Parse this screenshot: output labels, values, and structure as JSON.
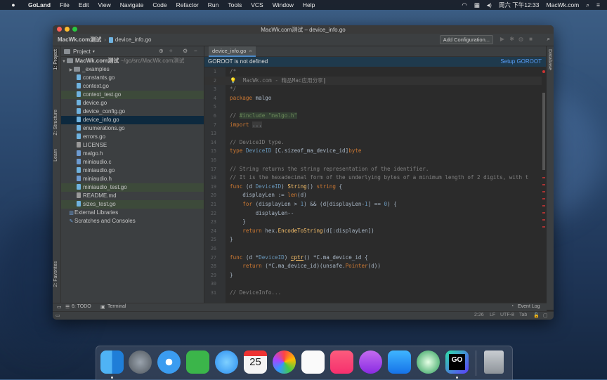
{
  "menubar": {
    "apple": "",
    "app": "GoLand",
    "items": [
      "File",
      "Edit",
      "View",
      "Navigate",
      "Code",
      "Refactor",
      "Run",
      "Tools",
      "VCS",
      "Window",
      "Help"
    ],
    "clock": "周六 下午12:33",
    "hostname": "MacWk.com"
  },
  "window": {
    "title": "MacWk.com测试 – device_info.go",
    "breadcrumb_project": "MacWk.com测试",
    "breadcrumb_file": "device_info.go",
    "add_configuration": "Add Configuration..."
  },
  "left_strip": {
    "project": "1: Project",
    "structure": "Z: Structure",
    "learn": "Learn",
    "favorites": "2: Favorites"
  },
  "right_strip": {
    "database": "Database"
  },
  "project_panel": {
    "title": "Project",
    "root_name": "MacWk.com测试",
    "root_path": "~/go/src/MacWk.com测试",
    "folder_examples": "_examples",
    "files": [
      {
        "name": "constants.go",
        "kind": "go",
        "modified": false
      },
      {
        "name": "context.go",
        "kind": "go",
        "modified": false
      },
      {
        "name": "context_test.go",
        "kind": "go",
        "modified": true
      },
      {
        "name": "device.go",
        "kind": "go",
        "modified": false
      },
      {
        "name": "device_config.go",
        "kind": "go",
        "modified": false
      },
      {
        "name": "device_info.go",
        "kind": "go",
        "selected": true
      },
      {
        "name": "enumerations.go",
        "kind": "go",
        "modified": false
      },
      {
        "name": "errors.go",
        "kind": "go",
        "modified": false
      },
      {
        "name": "LICENSE",
        "kind": "txt",
        "modified": false
      },
      {
        "name": "malgo.h",
        "kind": "c",
        "modified": false
      },
      {
        "name": "miniaudio.c",
        "kind": "c",
        "modified": false
      },
      {
        "name": "miniaudio.go",
        "kind": "go",
        "modified": false
      },
      {
        "name": "miniaudio.h",
        "kind": "c",
        "modified": false
      },
      {
        "name": "miniaudio_test.go",
        "kind": "go",
        "modified": true
      },
      {
        "name": "README.md",
        "kind": "txt",
        "modified": false
      },
      {
        "name": "sizes_test.go",
        "kind": "go",
        "modified": true
      }
    ],
    "external_libraries": "External Libraries",
    "scratches": "Scratches and Consoles"
  },
  "editor": {
    "tab_label": "device_info.go",
    "banner_message": "GOROOT is not defined",
    "banner_action": "Setup GOROOT",
    "line_numbers": [
      "1",
      "2",
      "3",
      "4",
      "5",
      "6",
      "7",
      "13",
      "14",
      "15",
      "16",
      "17",
      "18",
      "19",
      "20",
      "21",
      "22",
      "23",
      "24",
      "25",
      "26",
      "27",
      "28",
      "29",
      "30",
      "31"
    ]
  },
  "bottom_tools": {
    "todo": "6: TODO",
    "terminal": "Terminal",
    "event_log": "Event Log"
  },
  "status_bar": {
    "position": "2:26",
    "line_sep": "LF",
    "encoding": "UTF-8",
    "indent": "Tab"
  }
}
